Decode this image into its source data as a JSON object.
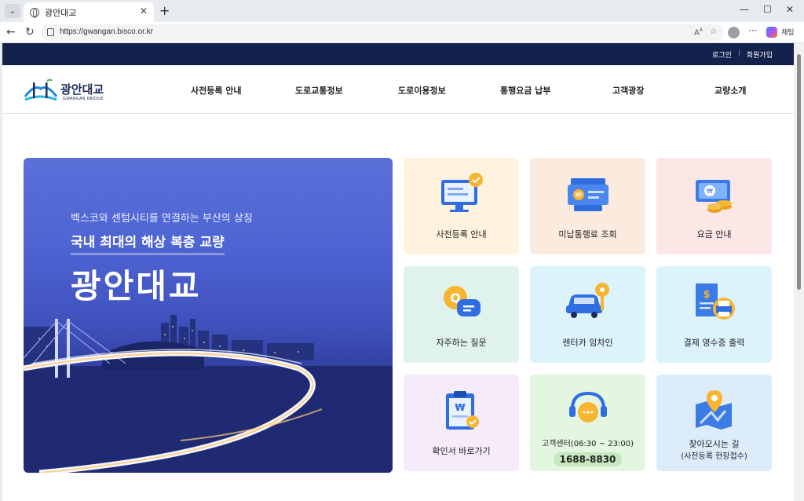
{
  "browser": {
    "tab_title": "광안대교",
    "url": "https://gwangan.bisco.or.kr",
    "chat_label": "채팅"
  },
  "topbar": {
    "login": "로그인",
    "signup": "회원가입"
  },
  "logo": {
    "name": "광안대교",
    "sub": "GWANGAN BRIDGE"
  },
  "nav": [
    {
      "label": "사전등록 안내"
    },
    {
      "label": "도로교통정보"
    },
    {
      "label": "도로이용정보"
    },
    {
      "label": "통행요금 납부"
    },
    {
      "label": "고객광장"
    },
    {
      "label": "교량소개"
    }
  ],
  "hero": {
    "tagline": "벡스코와 센텀시티를 연결하는 부산의 상징",
    "subtitle": "국내 최대의 해상 복층 교량",
    "title": "광안대교"
  },
  "quick_menu": {
    "pre_registration": "사전등록 안내",
    "unpaid_toll": "미납통행료 조회",
    "fee_guide": "요금 안내",
    "faq": "자주하는 질문",
    "rental_car": "렌터카 임차인",
    "receipt": "결제 영수증 출력",
    "certificate": "확인서 바로가기",
    "call_center_label": "고객센터(06:30 ~ 23:00)",
    "call_center_phone": "1688-8830",
    "directions_title": "찾아오시는 길",
    "directions_sub": "(사전등록 현장접수)"
  },
  "colors": {
    "topbar": "#15214d",
    "card_yellow": "#fff3df",
    "card_peach": "#fbeade",
    "card_pink": "#fde6e6",
    "card_mint": "#dff3ec",
    "card_sky": "#ddf3fb",
    "card_violet": "#f6ebfb",
    "card_green": "#e3f6e0",
    "card_blue": "#dcecfb"
  }
}
